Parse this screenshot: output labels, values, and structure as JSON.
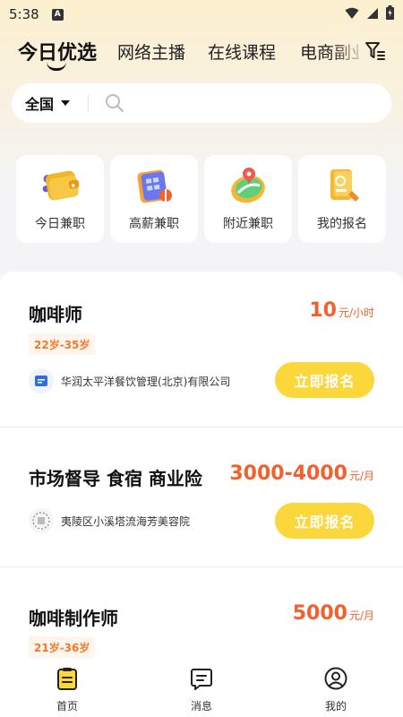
{
  "status": {
    "time": "5:38",
    "notif_letter": "A"
  },
  "tabs": [
    {
      "label": "今日优选",
      "active": true
    },
    {
      "label": "网络主播"
    },
    {
      "label": "在线课程"
    },
    {
      "label": "电商副业"
    }
  ],
  "search": {
    "region": "全国",
    "placeholder": ""
  },
  "categories": [
    {
      "label": "今日兼职",
      "icon": "wallet-icon"
    },
    {
      "label": "高薪兼职",
      "icon": "calendar-money-icon"
    },
    {
      "label": "附近兼职",
      "icon": "map-pin-icon"
    },
    {
      "label": "我的报名",
      "icon": "document-icon"
    }
  ],
  "jobs": [
    {
      "title": "咖啡师",
      "salary": "10",
      "unit": "元/小时",
      "tag": "22岁-35岁",
      "company": "华润太平洋餐饮管理(北京)有限公司",
      "apply": "立即报名"
    },
    {
      "title": "市场督导 食宿 商业险",
      "salary": "3000-4000",
      "unit": "元/月",
      "tag": "",
      "company": "夷陵区小溪塔流海芳美容院",
      "apply": "立即报名"
    },
    {
      "title": "咖啡制作师",
      "salary": "5000",
      "unit": "元/月",
      "tag": "21岁-36岁",
      "company": "",
      "apply": ""
    }
  ],
  "bottom_nav": [
    {
      "label": "首页",
      "icon": "home-icon",
      "active": true
    },
    {
      "label": "消息",
      "icon": "message-icon"
    },
    {
      "label": "我的",
      "icon": "profile-icon"
    }
  ],
  "colors": {
    "accent": "#fcd73c",
    "salary": "#f0612d",
    "tag_bg": "#fff5ec",
    "tag_text": "#f07a2a"
  }
}
